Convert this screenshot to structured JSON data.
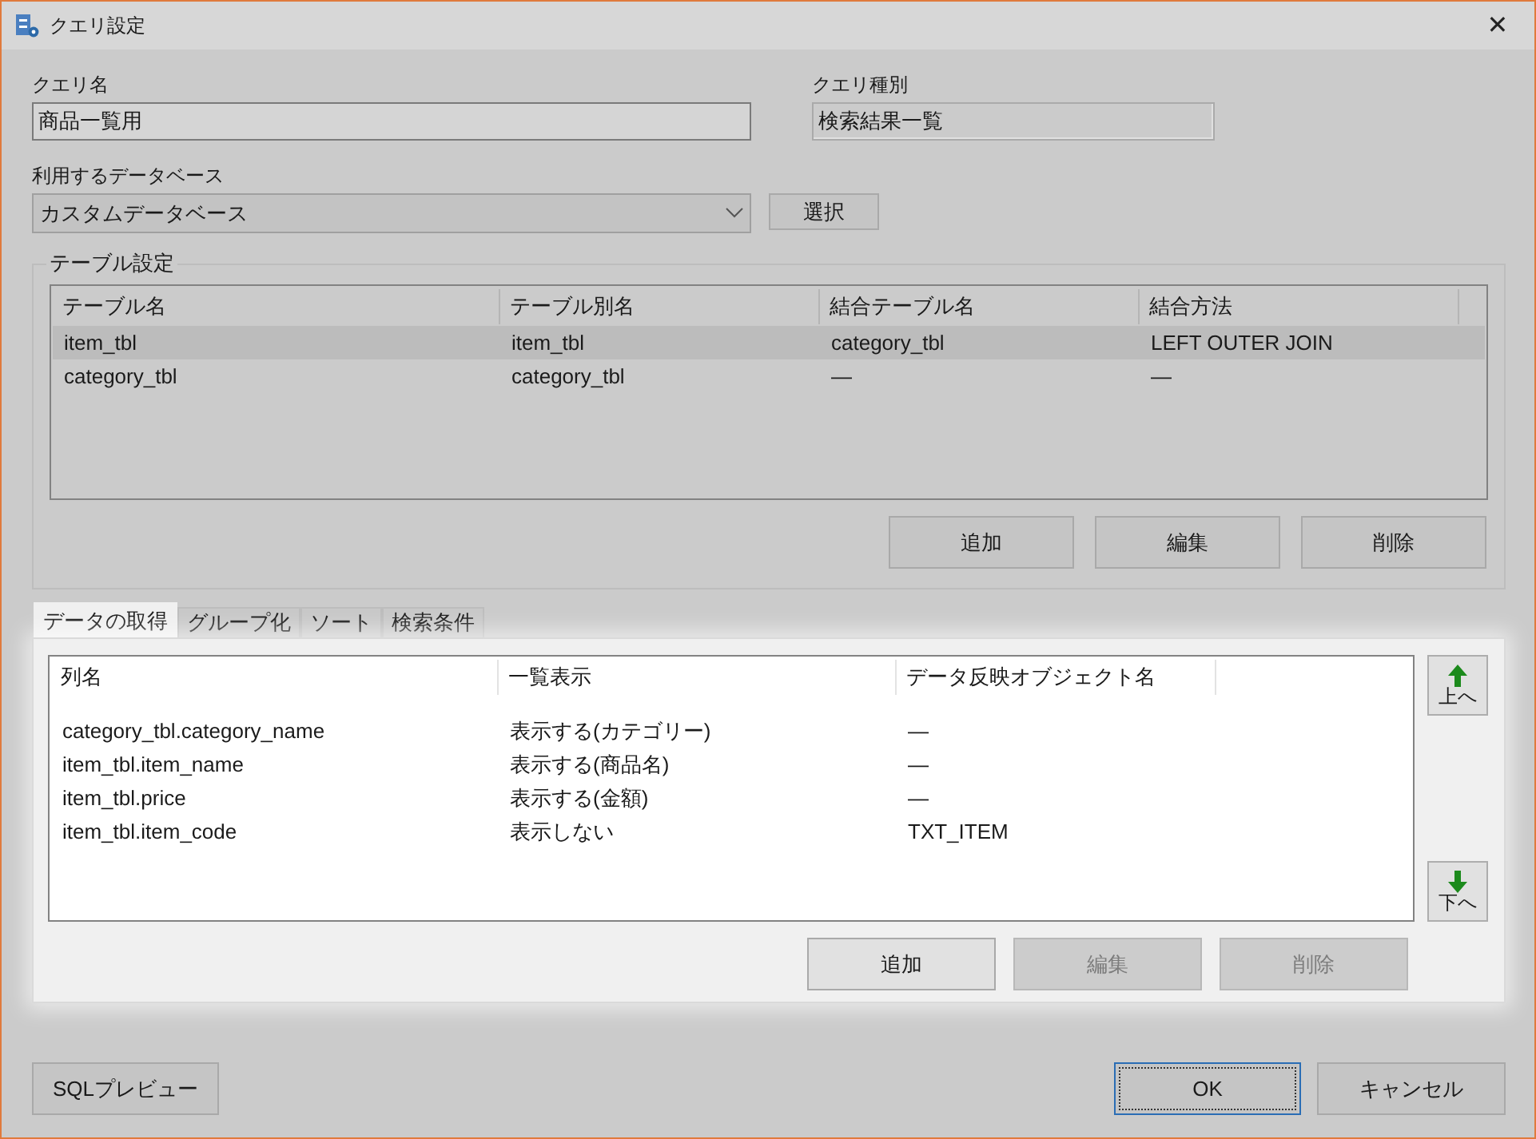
{
  "window": {
    "title": "クエリ設定",
    "close": "✕"
  },
  "query_name": {
    "label": "クエリ名",
    "value": "商品一覧用"
  },
  "query_type": {
    "label": "クエリ種別",
    "value": "検索結果一覧"
  },
  "database": {
    "label": "利用するデータベース",
    "value": "カスタムデータベース",
    "button": "選択"
  },
  "table_settings": {
    "title": "テーブル設定",
    "columns": [
      "テーブル名",
      "テーブル別名",
      "結合テーブル名",
      "結合方法"
    ],
    "rows": [
      {
        "cells": [
          "item_tbl",
          "item_tbl",
          "category_tbl",
          "LEFT OUTER JOIN"
        ],
        "selected": true
      },
      {
        "cells": [
          "category_tbl",
          "category_tbl",
          "—",
          "—"
        ],
        "selected": false
      }
    ],
    "buttons": [
      {
        "label": "追加",
        "disabled": false
      },
      {
        "label": "編集",
        "disabled": false
      },
      {
        "label": "削除",
        "disabled": false
      }
    ]
  },
  "tabs": [
    {
      "label": "データの取得",
      "selected": true
    },
    {
      "label": "グループ化",
      "selected": false
    },
    {
      "label": "ソート",
      "selected": false
    },
    {
      "label": "検索条件",
      "selected": false
    }
  ],
  "fields_list": {
    "columns": [
      "列名",
      "一覧表示",
      "データ反映オブジェクト名"
    ],
    "rows": [
      {
        "cells": [
          "category_tbl.category_name",
          "表示する(カテゴリー)",
          "—"
        ]
      },
      {
        "cells": [
          "item_tbl.item_name",
          "表示する(商品名)",
          "—"
        ]
      },
      {
        "cells": [
          "item_tbl.price",
          "表示する(金額)",
          "—"
        ]
      },
      {
        "cells": [
          "item_tbl.item_code",
          "表示しない",
          "TXT_ITEM"
        ]
      }
    ],
    "move_up": "上へ",
    "move_down": "下へ",
    "buttons": [
      {
        "label": "追加",
        "disabled": false
      },
      {
        "label": "編集",
        "disabled": true
      },
      {
        "label": "削除",
        "disabled": true
      }
    ]
  },
  "footer": {
    "preview_button": "SQLプレビュー",
    "ok_button": "OK",
    "cancel_button": "キャンセル"
  }
}
